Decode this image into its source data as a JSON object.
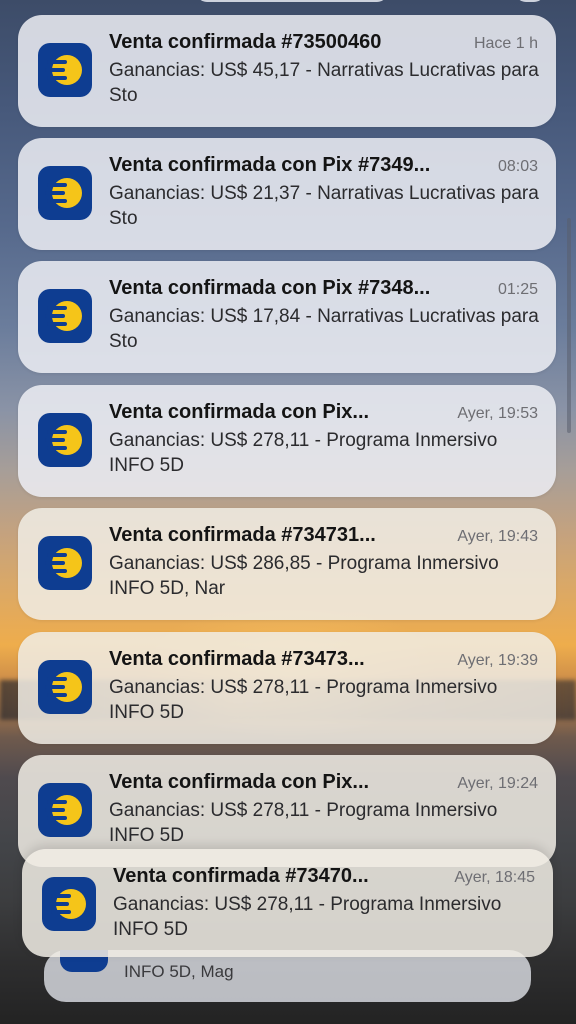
{
  "colors": {
    "icon_bg": "#0e3d91",
    "icon_fg": "#f5c519"
  },
  "notifications": [
    {
      "title": "Venta confirmada #73500460",
      "time": "Hace 1 h",
      "body": "Ganancias: US$ 45,17 - Narrativas Lucrativas para Sto"
    },
    {
      "title": "Venta confirmada con Pix #7349...",
      "time": "08:03",
      "body": "Ganancias: US$ 21,37 - Narrativas Lucrativas para Sto"
    },
    {
      "title": "Venta confirmada con Pix #7348...",
      "time": "01:25",
      "body": "Ganancias: US$ 17,84 - Narrativas Lucrativas para Sto"
    },
    {
      "title": "Venta confirmada con Pix...",
      "time": "Ayer, 19:53",
      "body": "Ganancias: US$ 278,11 - Programa Inmersivo INFO 5D"
    },
    {
      "title": "Venta confirmada #734731...",
      "time": "Ayer, 19:43",
      "body": "Ganancias: US$ 286,85 - Programa Inmersivo INFO 5D, Nar"
    },
    {
      "title": "Venta confirmada #73473...",
      "time": "Ayer, 19:39",
      "body": "Ganancias: US$ 278,11 - Programa Inmersivo INFO 5D"
    },
    {
      "title": "Venta confirmada con Pix...",
      "time": "Ayer, 19:24",
      "body": "Ganancias: US$ 278,11 - Programa Inmersivo INFO 5D"
    },
    {
      "title": "Venta confirmada #73470...",
      "time": "Ayer, 18:45",
      "body": "Ganancias: US$ 278,11 - Programa Inmersivo INFO 5D"
    }
  ],
  "stack_peek": {
    "body": "INFO 5D, Mag"
  },
  "app_icon_name": "eduzz-logo-icon"
}
